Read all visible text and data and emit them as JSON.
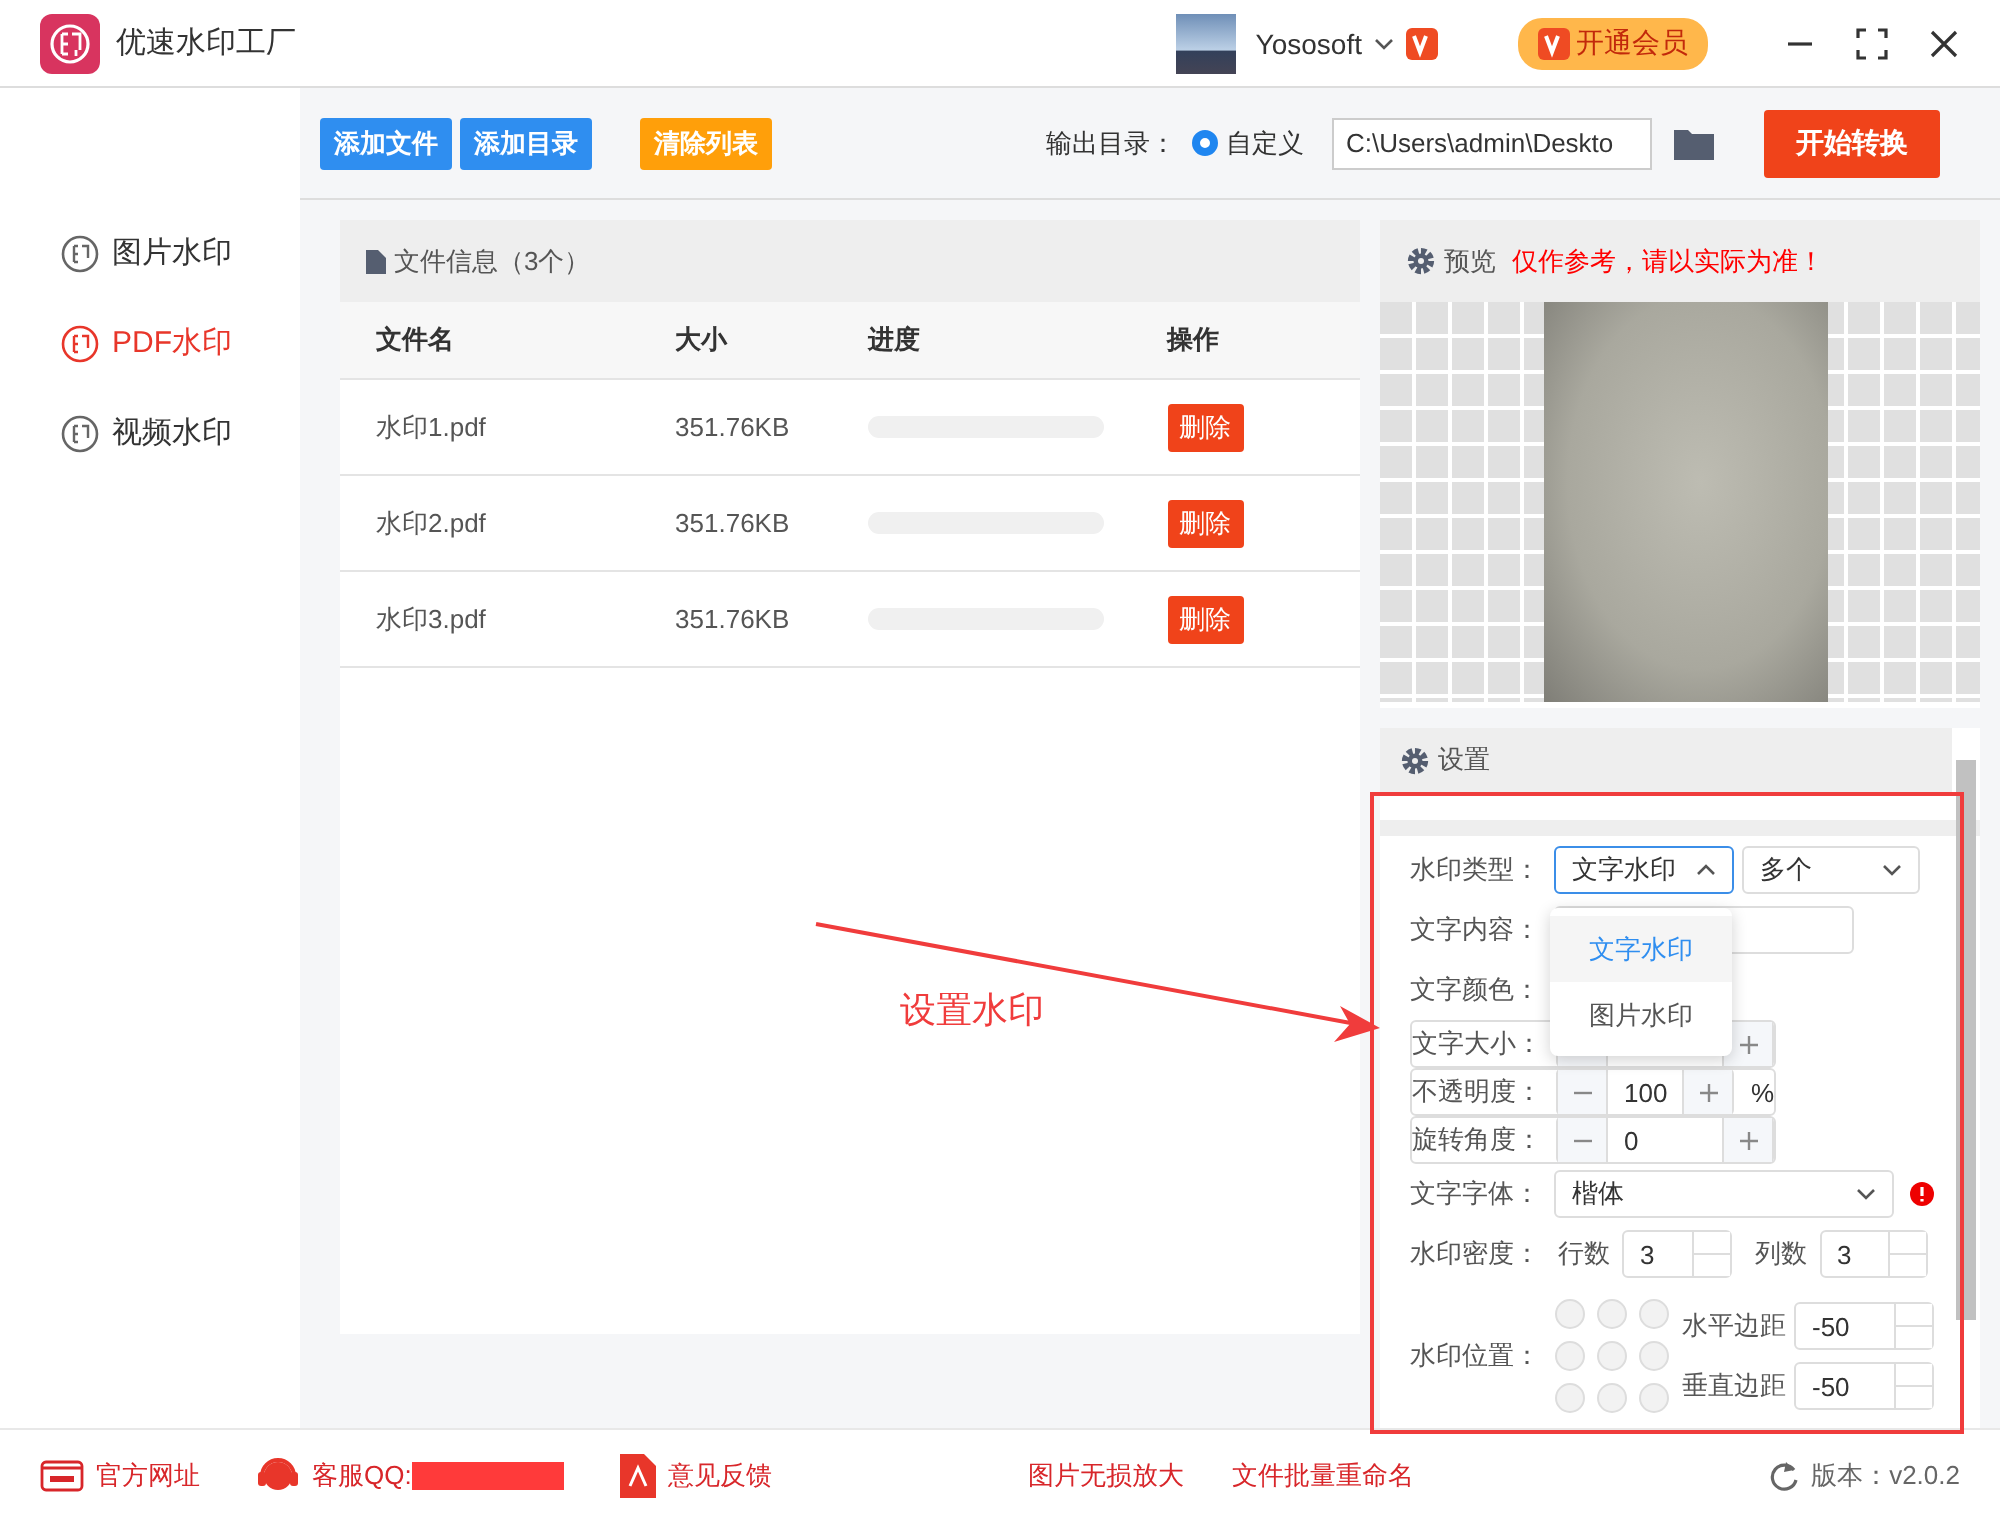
{
  "app": {
    "title": "优速水印工厂"
  },
  "user": {
    "name": "Yososoft"
  },
  "vip_button": "开通会员",
  "sidebar": [
    {
      "label": "图片水印",
      "selected": false
    },
    {
      "label": "PDF水印",
      "selected": true
    },
    {
      "label": "视频水印",
      "selected": false
    }
  ],
  "toolbar": {
    "buttons": [
      {
        "label": "添加文件",
        "kind": "primary"
      },
      {
        "label": "添加目录",
        "kind": "primary"
      },
      {
        "label": "清除列表",
        "kind": "warning"
      }
    ],
    "output_label": "输出目录：",
    "radio": {
      "label": "自定义",
      "selected": true
    },
    "path": "C:\\Users\\admin\\Deskto",
    "start": "开始转换"
  },
  "files": {
    "title": "文件信息（3个）",
    "columns": [
      "文件名",
      "大小",
      "进度",
      "操作"
    ],
    "rows": [
      {
        "name": "水印1.pdf",
        "size": "351.76KB",
        "level": 0,
        "action": "删除"
      },
      {
        "name": "水印2.pdf",
        "size": "351.76KB",
        "level": 0,
        "action": "删除"
      },
      {
        "name": "水印3.pdf",
        "size": "351.76KB",
        "level": 0,
        "action": "删除"
      }
    ]
  },
  "preview": {
    "title": "预览",
    "note": "仅作参考，请以实际为准！"
  },
  "settings": {
    "title": "设置",
    "fields": [
      {
        "kind": "type",
        "label": "水印类型：",
        "value": "文字水印",
        "value2": "多个",
        "expanded": true
      },
      {
        "kind": "text",
        "label": "文字内容："
      },
      {
        "kind": "color",
        "label": "文字颜色："
      },
      {
        "kind": "stepper",
        "label": "文字大小："
      },
      {
        "kind": "stepper",
        "label": "不透明度：",
        "value": "100",
        "unit": "%"
      },
      {
        "kind": "stepper",
        "label": "旋转角度：",
        "value": "0"
      },
      {
        "kind": "select",
        "label": "文字字体：",
        "value": "楷体",
        "warning": true
      },
      {
        "kind": "density",
        "label": "水印密度：",
        "rows_label": "行数",
        "rows": "3",
        "cols_label": "列数",
        "cols": "3"
      },
      {
        "kind": "position",
        "label": "水印位置：",
        "h_label": "水平边距",
        "h": "-50",
        "v_label": "垂直边距",
        "v": "-50"
      }
    ]
  },
  "dropdown": {
    "options": [
      {
        "label": "文字水印",
        "selected": true
      },
      {
        "label": "图片水印",
        "selected": false
      }
    ]
  },
  "annotation": {
    "label": "设置水印"
  },
  "footer": {
    "links": [
      {
        "kind": "site",
        "label": "官方网址"
      },
      {
        "kind": "qq",
        "label": "客服QQ:"
      },
      {
        "kind": "feedback",
        "label": "意见反馈"
      }
    ],
    "promos": [
      "图片无损放大",
      "文件批量重命名"
    ],
    "version": "版本：v2.0.2"
  }
}
